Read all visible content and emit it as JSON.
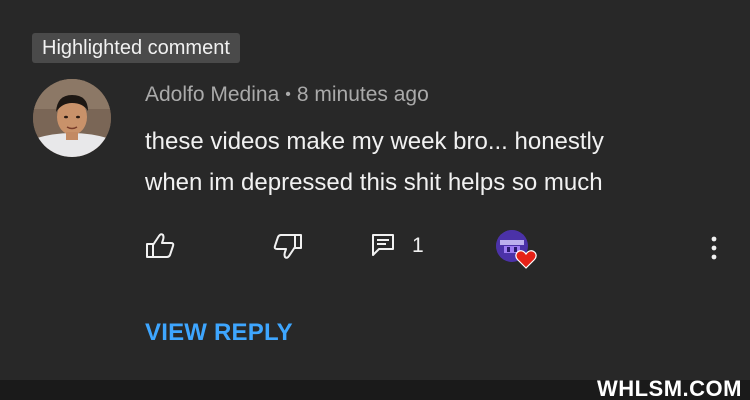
{
  "badge": {
    "label": "Highlighted comment"
  },
  "comment": {
    "author": "Adolfo Medina",
    "separator": "•",
    "time": "8 minutes ago",
    "text_line1": "these videos make my week bro... honestly",
    "text_line2": "when im depressed this shit helps so much",
    "reply_count": "1",
    "view_reply_label": "VIEW REPLY"
  },
  "icons": {
    "like": "thumbs-up-icon",
    "dislike": "thumbs-down-icon",
    "reply": "comment-reply-icon",
    "creator_heart": "heart-icon",
    "more": "more-vertical-icon"
  },
  "colors": {
    "background": "#282828",
    "link": "#3ea6ff",
    "heart": "#e62117",
    "muted_text": "#aaaaaa"
  },
  "watermark": "WHLSM.COM"
}
